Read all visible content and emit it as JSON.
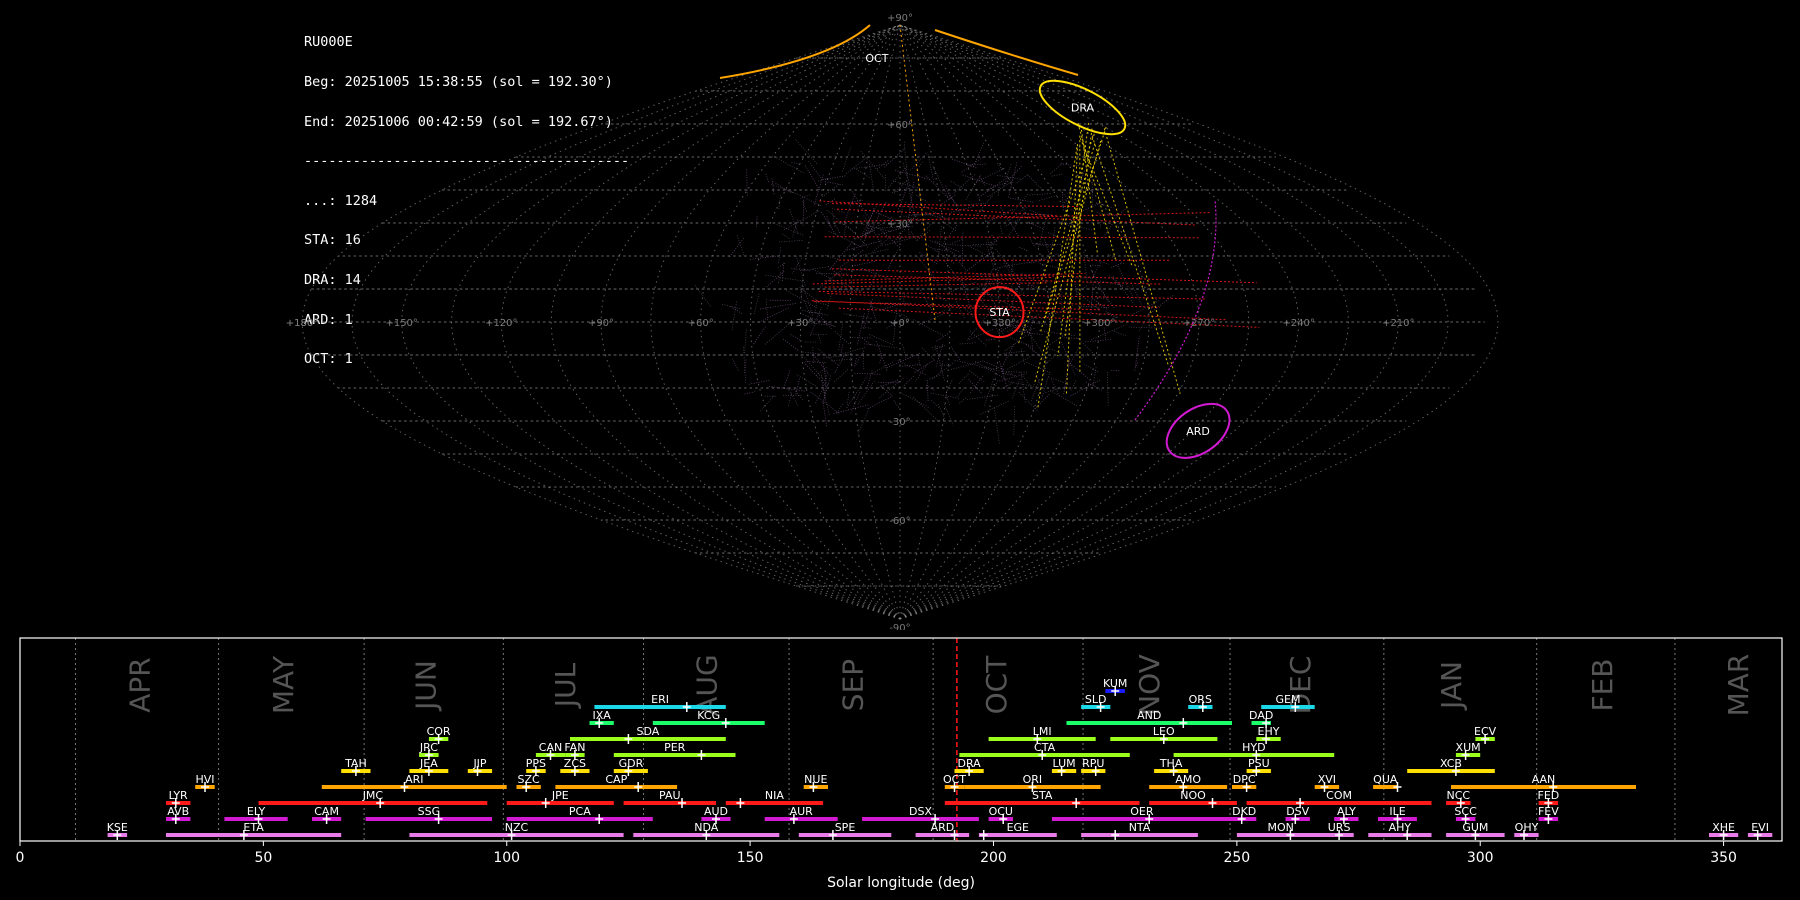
{
  "info": {
    "station": "RU000E",
    "beg": "Beg: 20251005 15:38:55 (sol = 192.30°)",
    "end": "End: 20251006 00:42:59 (sol = 192.67°)",
    "separator": "----------------------------------------",
    "counts": [
      {
        "label": "...: 1284"
      },
      {
        "label": "STA: 16"
      },
      {
        "label": "DRA: 14"
      },
      {
        "label": "ARD: 1"
      },
      {
        "label": "OCT: 1"
      }
    ]
  },
  "colors": {
    "background": "#000000",
    "grid": "#8a8a8a",
    "sporadic": "#a070b0",
    "red": "#ff1a1a",
    "orange": "#ffa500",
    "yellow": "#ffe000",
    "lime": "#9aff1a",
    "green": "#1aff6a",
    "cyan": "#1ad8e8",
    "blue": "#1a1aff",
    "magenta": "#d21ad2",
    "pink": "#e87be8"
  },
  "sky_map": {
    "lon_ticks": [
      "+180°",
      "+150°",
      "+120°",
      "+90°",
      "+60°",
      "+30°",
      "+0°",
      "+330°",
      "+300°",
      "+270°",
      "+240°",
      "+210°",
      "+180°"
    ],
    "lat_ticks": [
      "+90°",
      "+60°",
      "+30°",
      "-30°",
      "-60°",
      "-90°"
    ],
    "radiants": [
      {
        "name": "STA",
        "lon": 330,
        "lat": 3,
        "rx": 24,
        "ry": 25,
        "rot": 0,
        "color": "#ff1a1a"
      },
      {
        "name": "DRA",
        "lon": 230,
        "lat": 65,
        "rx": 47,
        "ry": 18,
        "rot": 27,
        "color": "#ffe000"
      },
      {
        "name": "ARD",
        "lon": 253,
        "lat": -33,
        "rx": 35,
        "ry": 22,
        "rot": -35,
        "color": "#d21ad2"
      },
      {
        "name": "OCT",
        "lon": 40,
        "lat": 80,
        "color": "#ffa500"
      }
    ]
  },
  "chart_data": {
    "type": "timeline",
    "xlabel": "Solar longitude (deg)",
    "xlim": [
      0,
      362
    ],
    "xticks": [
      "0",
      "50",
      "100",
      "150",
      "200",
      "250",
      "300",
      "350"
    ],
    "current_sol": 192.48,
    "months": [
      {
        "name": "APR",
        "start": 11.4,
        "mid": 24.5
      },
      {
        "name": "MAY",
        "start": 40.8,
        "mid": 54.0
      },
      {
        "name": "JUN",
        "start": 70.7,
        "mid": 83.3
      },
      {
        "name": "JUL",
        "start": 99.3,
        "mid": 112.0
      },
      {
        "name": "AUG",
        "start": 128.1,
        "mid": 141.0
      },
      {
        "name": "SEP",
        "start": 158.0,
        "mid": 171.0
      },
      {
        "name": "OCT",
        "start": 187.6,
        "mid": 200.5
      },
      {
        "name": "NOV",
        "start": 218.4,
        "mid": 232.0
      },
      {
        "name": "DEC",
        "start": 248.6,
        "mid": 263.0
      },
      {
        "name": "JAN",
        "start": 280.2,
        "mid": 294.0
      },
      {
        "name": "FEB",
        "start": 311.6,
        "mid": 325.0
      },
      {
        "name": "MAR",
        "start": 340.0,
        "mid": 353.0
      }
    ],
    "showers": [
      {
        "code": "KUM",
        "start": 223,
        "end": 227,
        "peak": 225,
        "row": 9,
        "color": "#1a1aff"
      },
      {
        "code": "ERI",
        "start": 118,
        "end": 145,
        "peak": 137,
        "row": 8,
        "color": "#1ad8e8"
      },
      {
        "code": "SLD",
        "start": 218,
        "end": 224,
        "peak": 222,
        "row": 8,
        "color": "#1ad8e8"
      },
      {
        "code": "ORS",
        "start": 240,
        "end": 245,
        "peak": 243,
        "row": 8,
        "color": "#1ad8e8"
      },
      {
        "code": "GEM",
        "start": 255,
        "end": 266,
        "peak": 262,
        "row": 8,
        "color": "#1ad8e8"
      },
      {
        "code": "IXA",
        "start": 117,
        "end": 122,
        "peak": 119,
        "row": 7,
        "color": "#1aff6a"
      },
      {
        "code": "KCG",
        "start": 130,
        "end": 153,
        "peak": 145,
        "row": 7,
        "color": "#1aff6a"
      },
      {
        "code": "AND",
        "start": 215,
        "end": 249,
        "peak": 239,
        "row": 7,
        "color": "#1aff6a"
      },
      {
        "code": "DAD",
        "start": 253,
        "end": 257,
        "peak": 256,
        "row": 7,
        "color": "#1aff6a"
      },
      {
        "code": "COR",
        "start": 84,
        "end": 88,
        "peak": 86,
        "row": 6,
        "color": "#9aff1a"
      },
      {
        "code": "SDA",
        "start": 113,
        "end": 145,
        "peak": 125,
        "row": 6,
        "color": "#9aff1a"
      },
      {
        "code": "LMI",
        "start": 199,
        "end": 221,
        "peak": 209,
        "row": 6,
        "color": "#9aff1a"
      },
      {
        "code": "LEO",
        "start": 224,
        "end": 246,
        "peak": 235,
        "row": 6,
        "color": "#9aff1a"
      },
      {
        "code": "EHY",
        "start": 254,
        "end": 259,
        "peak": 256,
        "row": 6,
        "color": "#9aff1a"
      },
      {
        "code": "ECV",
        "start": 299,
        "end": 303,
        "peak": 301,
        "row": 6,
        "color": "#9aff1a"
      },
      {
        "code": "JRC",
        "start": 82,
        "end": 86,
        "peak": 84,
        "row": 5,
        "color": "#9aff1a"
      },
      {
        "code": "CAN",
        "start": 106,
        "end": 112,
        "peak": 109,
        "row": 5,
        "color": "#9aff1a"
      },
      {
        "code": "FAN",
        "start": 112,
        "end": 116,
        "peak": 114,
        "row": 5,
        "color": "#9aff1a"
      },
      {
        "code": "PER",
        "start": 122,
        "end": 147,
        "peak": 140,
        "row": 5,
        "color": "#9aff1a"
      },
      {
        "code": "CTA",
        "start": 193,
        "end": 228,
        "peak": 210,
        "row": 5,
        "color": "#9aff1a"
      },
      {
        "code": "HYD",
        "start": 237,
        "end": 270,
        "peak": 254,
        "row": 5,
        "color": "#9aff1a"
      },
      {
        "code": "XUM",
        "start": 295,
        "end": 300,
        "peak": 297,
        "row": 5,
        "color": "#9aff1a"
      },
      {
        "code": "TAH",
        "start": 66,
        "end": 72,
        "peak": 69,
        "row": 4,
        "color": "#ffe000"
      },
      {
        "code": "JEA",
        "start": 80,
        "end": 88,
        "peak": 84,
        "row": 4,
        "color": "#ffe000"
      },
      {
        "code": "JIP",
        "start": 92,
        "end": 97,
        "peak": 94,
        "row": 4,
        "color": "#ffe000"
      },
      {
        "code": "PPS",
        "start": 104,
        "end": 108,
        "peak": 106,
        "row": 4,
        "color": "#ffe000"
      },
      {
        "code": "ZCS",
        "start": 111,
        "end": 117,
        "peak": 114,
        "row": 4,
        "color": "#ffe000"
      },
      {
        "code": "GDR",
        "start": 122,
        "end": 129,
        "peak": 125,
        "row": 4,
        "color": "#ffe000"
      },
      {
        "code": "DRA",
        "start": 192,
        "end": 198,
        "peak": 195,
        "row": 4,
        "color": "#ffe000"
      },
      {
        "code": "LUM",
        "start": 212,
        "end": 217,
        "peak": 214,
        "row": 4,
        "color": "#ffe000"
      },
      {
        "code": "RPU",
        "start": 218,
        "end": 223,
        "peak": 221,
        "row": 4,
        "color": "#ffe000"
      },
      {
        "code": "THA",
        "start": 233,
        "end": 240,
        "peak": 237,
        "row": 4,
        "color": "#ffe000"
      },
      {
        "code": "PSU",
        "start": 252,
        "end": 257,
        "peak": 254,
        "row": 4,
        "color": "#ffe000"
      },
      {
        "code": "XCB",
        "start": 285,
        "end": 303,
        "peak": 295,
        "row": 4,
        "color": "#ffe000"
      },
      {
        "code": "HVI",
        "start": 36,
        "end": 40,
        "peak": 38,
        "row": 3,
        "color": "#ffa500"
      },
      {
        "code": "ARI",
        "start": 62,
        "end": 100,
        "peak": 79,
        "row": 3,
        "color": "#ffa500"
      },
      {
        "code": "SZC",
        "start": 102,
        "end": 107,
        "peak": 104,
        "row": 3,
        "color": "#ffa500"
      },
      {
        "code": "CAP",
        "start": 110,
        "end": 135,
        "peak": 127,
        "row": 3,
        "color": "#ffa500"
      },
      {
        "code": "NUE",
        "start": 161,
        "end": 166,
        "peak": 163,
        "row": 3,
        "color": "#ffa500"
      },
      {
        "code": "OCT",
        "start": 190,
        "end": 194,
        "peak": 192,
        "row": 3,
        "color": "#ffa500"
      },
      {
        "code": "ORI",
        "start": 194,
        "end": 222,
        "peak": 208,
        "row": 3,
        "color": "#ffa500"
      },
      {
        "code": "AMO",
        "start": 232,
        "end": 248,
        "peak": 239,
        "row": 3,
        "color": "#ffa500"
      },
      {
        "code": "DPC",
        "start": 249,
        "end": 254,
        "peak": 252,
        "row": 3,
        "color": "#ffa500"
      },
      {
        "code": "XVI",
        "start": 266,
        "end": 271,
        "peak": 268,
        "row": 3,
        "color": "#ffa500"
      },
      {
        "code": "QUA",
        "start": 278,
        "end": 283,
        "peak": 283,
        "row": 3,
        "color": "#ffa500"
      },
      {
        "code": "AAN",
        "start": 294,
        "end": 332,
        "peak": 315,
        "row": 3,
        "color": "#ffa500"
      },
      {
        "code": "LYR",
        "start": 30,
        "end": 35,
        "peak": 32,
        "row": 2,
        "color": "#ff1a1a"
      },
      {
        "code": "JMC",
        "start": 49,
        "end": 96,
        "peak": 74,
        "row": 2,
        "color": "#ff1a1a"
      },
      {
        "code": "JPE",
        "start": 100,
        "end": 122,
        "peak": 108,
        "row": 2,
        "color": "#ff1a1a"
      },
      {
        "code": "PAU",
        "start": 124,
        "end": 143,
        "peak": 136,
        "row": 2,
        "color": "#ff1a1a"
      },
      {
        "code": "NIA",
        "start": 145,
        "end": 165,
        "peak": 148,
        "row": 2,
        "color": "#ff1a1a"
      },
      {
        "code": "STA",
        "start": 190,
        "end": 230,
        "peak": 217,
        "row": 2,
        "color": "#ff1a1a"
      },
      {
        "code": "NOO",
        "start": 232,
        "end": 250,
        "peak": 245,
        "row": 2,
        "color": "#ff1a1a"
      },
      {
        "code": "COM",
        "start": 252,
        "end": 290,
        "peak": 263,
        "row": 2,
        "color": "#ff1a1a"
      },
      {
        "code": "NCC",
        "start": 293,
        "end": 298,
        "peak": 296,
        "row": 2,
        "color": "#ff1a1a"
      },
      {
        "code": "FED",
        "start": 312,
        "end": 316,
        "peak": 314,
        "row": 2,
        "color": "#ff1a1a"
      },
      {
        "code": "AVB",
        "start": 30,
        "end": 35,
        "peak": 32,
        "row": 1,
        "color": "#d21ad2"
      },
      {
        "code": "ELY",
        "start": 42,
        "end": 55,
        "peak": 49,
        "row": 1,
        "color": "#d21ad2"
      },
      {
        "code": "CAM",
        "start": 60,
        "end": 66,
        "peak": 63,
        "row": 1,
        "color": "#d21ad2"
      },
      {
        "code": "SSG",
        "start": 71,
        "end": 97,
        "peak": 86,
        "row": 1,
        "color": "#d21ad2"
      },
      {
        "code": "PCA",
        "start": 100,
        "end": 130,
        "peak": 119,
        "row": 1,
        "color": "#d21ad2"
      },
      {
        "code": "AUD",
        "start": 140,
        "end": 146,
        "peak": 143,
        "row": 1,
        "color": "#d21ad2"
      },
      {
        "code": "AUR",
        "start": 153,
        "end": 168,
        "peak": 159,
        "row": 1,
        "color": "#d21ad2"
      },
      {
        "code": "DSX",
        "start": 173,
        "end": 197,
        "peak": 188,
        "row": 1,
        "color": "#d21ad2"
      },
      {
        "code": "OCU",
        "start": 199,
        "end": 204,
        "peak": 202,
        "row": 1,
        "color": "#d21ad2"
      },
      {
        "code": "OER",
        "start": 212,
        "end": 249,
        "peak": 232,
        "row": 1,
        "color": "#d21ad2"
      },
      {
        "code": "DKD",
        "start": 249,
        "end": 254,
        "peak": 251,
        "row": 1,
        "color": "#d21ad2"
      },
      {
        "code": "DSV",
        "start": 260,
        "end": 265,
        "peak": 262,
        "row": 1,
        "color": "#d21ad2"
      },
      {
        "code": "ALY",
        "start": 270,
        "end": 275,
        "peak": 272,
        "row": 1,
        "color": "#d21ad2"
      },
      {
        "code": "ILE",
        "start": 279,
        "end": 287,
        "peak": 283,
        "row": 1,
        "color": "#d21ad2"
      },
      {
        "code": "SCC",
        "start": 295,
        "end": 299,
        "peak": 297,
        "row": 1,
        "color": "#d21ad2"
      },
      {
        "code": "FEV",
        "start": 312,
        "end": 316,
        "peak": 314,
        "row": 1,
        "color": "#d21ad2"
      },
      {
        "code": "KSE",
        "start": 18,
        "end": 22,
        "peak": 20,
        "row": 0,
        "color": "#e87be8"
      },
      {
        "code": "ETA",
        "start": 30,
        "end": 66,
        "peak": 46,
        "row": 0,
        "color": "#e87be8"
      },
      {
        "code": "NZC",
        "start": 80,
        "end": 124,
        "peak": 101,
        "row": 0,
        "color": "#e87be8"
      },
      {
        "code": "NDA",
        "start": 126,
        "end": 156,
        "peak": 141,
        "row": 0,
        "color": "#e87be8"
      },
      {
        "code": "SPE",
        "start": 160,
        "end": 179,
        "peak": 167,
        "row": 0,
        "color": "#e87be8"
      },
      {
        "code": "ARD",
        "start": 184,
        "end": 195,
        "peak": 192,
        "row": 0,
        "color": "#e87be8"
      },
      {
        "code": "EGE",
        "start": 197,
        "end": 213,
        "peak": 198,
        "row": 0,
        "color": "#e87be8"
      },
      {
        "code": "NTA",
        "start": 218,
        "end": 242,
        "peak": 225,
        "row": 0,
        "color": "#e87be8"
      },
      {
        "code": "MON",
        "start": 250,
        "end": 268,
        "peak": 261,
        "row": 0,
        "color": "#e87be8"
      },
      {
        "code": "URS",
        "start": 268,
        "end": 274,
        "peak": 271,
        "row": 0,
        "color": "#e87be8"
      },
      {
        "code": "AHY",
        "start": 277,
        "end": 290,
        "peak": 285,
        "row": 0,
        "color": "#e87be8"
      },
      {
        "code": "GUM",
        "start": 293,
        "end": 305,
        "peak": 299,
        "row": 0,
        "color": "#e87be8"
      },
      {
        "code": "OHY",
        "start": 307,
        "end": 312,
        "peak": 309,
        "row": 0,
        "color": "#e87be8"
      },
      {
        "code": "XHE",
        "start": 347,
        "end": 353,
        "peak": 350,
        "row": 0,
        "color": "#e87be8"
      },
      {
        "code": "EVI",
        "start": 355,
        "end": 360,
        "peak": 357,
        "row": 0,
        "color": "#e87be8"
      }
    ]
  }
}
